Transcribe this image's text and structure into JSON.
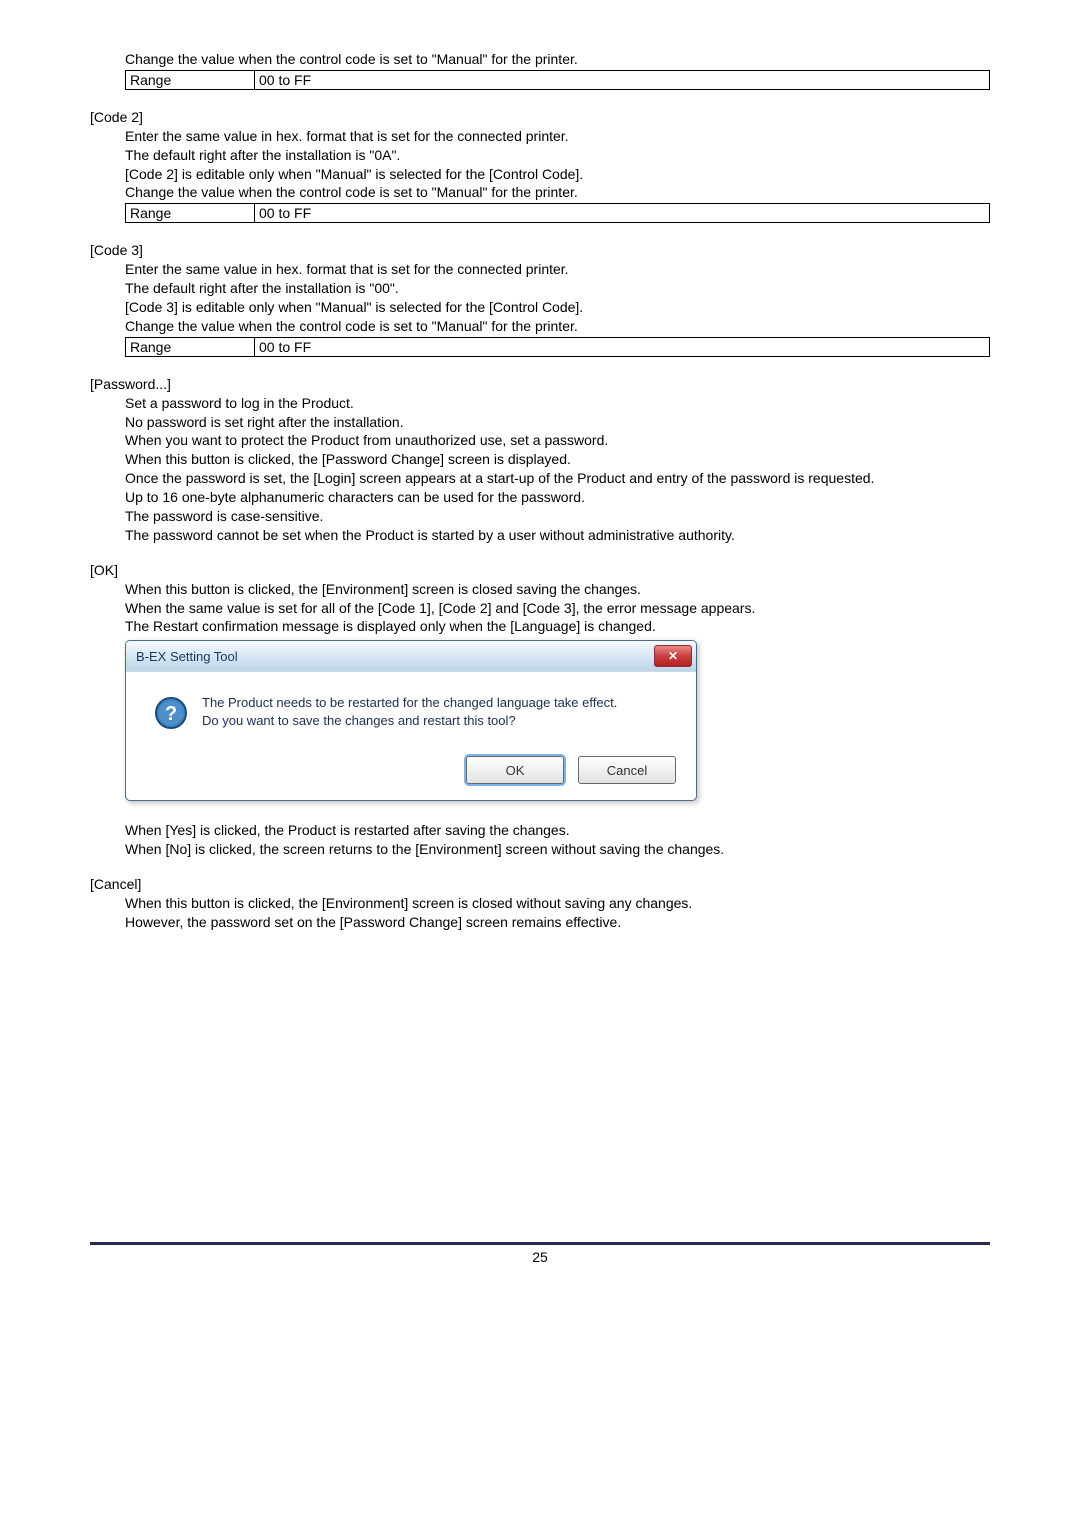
{
  "intro": {
    "change_line": "Change the value when the control code is set to \"Manual\" for the printer."
  },
  "range_table": {
    "label": "Range",
    "value": "00 to FF"
  },
  "code2": {
    "heading": "[Code 2]",
    "l1": "Enter the same value in hex. format that is set for the connected printer.",
    "l2": "The default right after the installation is \"0A\".",
    "l3": "[Code 2] is editable only when \"Manual\" is selected for the [Control Code].",
    "l4": "Change the value when the control code is set to \"Manual\" for the printer."
  },
  "code3": {
    "heading": "[Code 3]",
    "l1": "Enter the same value in hex. format that is set for the connected printer.",
    "l2": "The default right after the installation is \"00\".",
    "l3": "[Code 3] is editable only when \"Manual\" is selected for the [Control Code].",
    "l4": "Change the value when the control code is set to \"Manual\" for the printer."
  },
  "password": {
    "heading": "[Password...]",
    "l1": "Set a password to log in the Product.",
    "l2": "No password is set right after the installation.",
    "l3": "When you want to protect the Product from unauthorized use, set a password.",
    "l4": "When this button is clicked, the [Password Change] screen is displayed.",
    "l5": "Once the password is set, the [Login] screen appears at a start-up of the Product and entry of the password is requested.",
    "l6": "Up to 16 one-byte alphanumeric characters can be used for the password.",
    "l7": "The password is case-sensitive.",
    "l8": "The password cannot be set when the Product is started by a user without administrative authority."
  },
  "ok": {
    "heading": "[OK]",
    "l1": "When this button is clicked, the [Environment] screen is closed saving the changes.",
    "l2": "When the same value is set for all of the [Code 1], [Code 2] and [Code 3], the error message appears.",
    "l3": "The Restart confirmation message is displayed only when the [Language] is changed."
  },
  "dialog": {
    "title": "B-EX Setting Tool",
    "msg1": "The Product needs to be restarted for the changed language take effect.",
    "msg2": "Do you want to save the changes and restart this tool?",
    "ok": "OK",
    "cancel": "Cancel",
    "close_glyph": "✕"
  },
  "after_dialog": {
    "l1": "When [Yes] is clicked, the Product is restarted after saving the changes.",
    "l2": "When [No] is clicked, the screen returns to the [Environment] screen without saving the changes."
  },
  "cancel": {
    "heading": "[Cancel]",
    "l1": "When this button is clicked, the [Environment] screen is closed without saving any changes.",
    "l2": "However, the password set on the [Password Change] screen remains effective."
  },
  "page_number": "25"
}
